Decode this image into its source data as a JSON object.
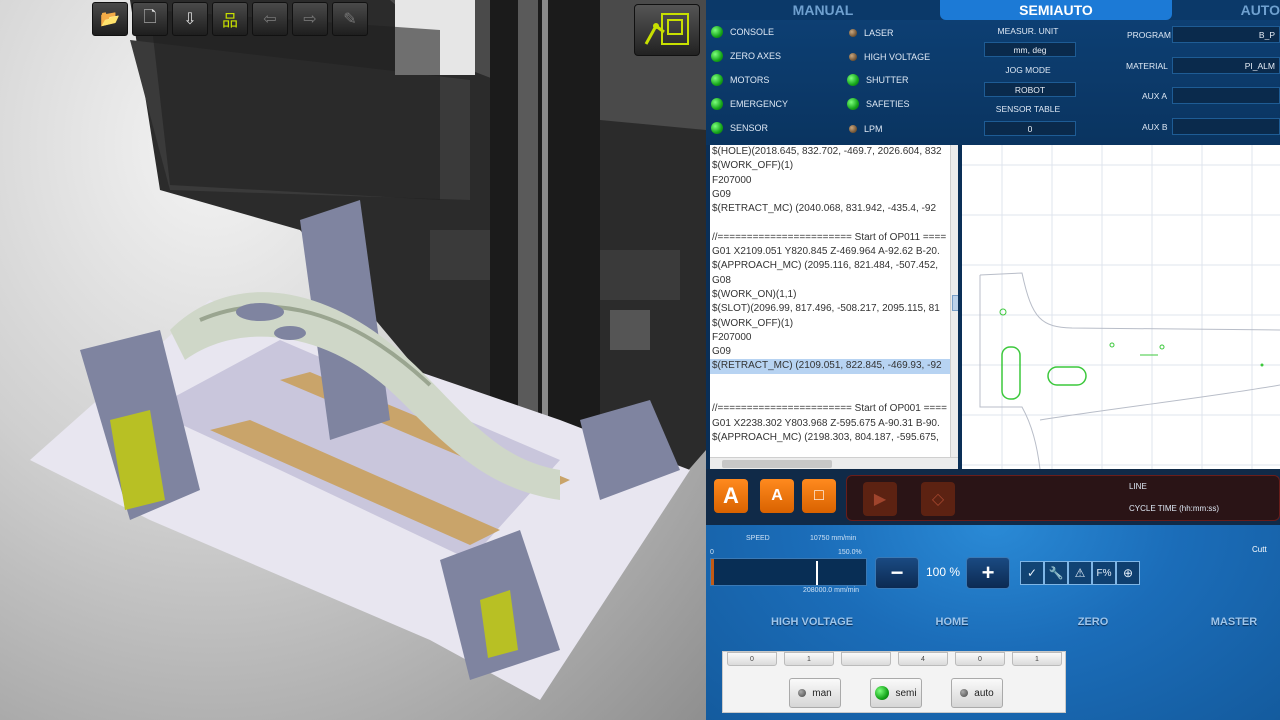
{
  "toolbar": {
    "items": [
      {
        "name": "open-folder",
        "glyph": "📂"
      },
      {
        "name": "new-document",
        "glyph": "🗋"
      },
      {
        "name": "export",
        "glyph": "⇩"
      },
      {
        "name": "hierarchy",
        "glyph": "品"
      },
      {
        "name": "arrow-left",
        "glyph": "⇦"
      },
      {
        "name": "arrow-right",
        "glyph": "⇨"
      },
      {
        "name": "pen",
        "glyph": "✎"
      }
    ]
  },
  "modes": [
    "MANUAL",
    "SEMIAUTO",
    "AUTO"
  ],
  "active_mode": "SEMIAUTO",
  "status": {
    "col1": [
      "CONSOLE",
      "ZERO AXES",
      "MOTORS",
      "EMERGENCY",
      "SENSOR"
    ],
    "col2": [
      "LASER",
      "HIGH VOLTAGE",
      "SHUTTER",
      "SAFETIES",
      "LPM"
    ],
    "units": [
      {
        "label": "MEASUR. UNIT",
        "value": "mm, deg"
      },
      {
        "label": "JOG MODE",
        "value": "ROBOT"
      },
      {
        "label": "SENSOR TABLE",
        "value": "0"
      }
    ],
    "fields": [
      {
        "label": "PROGRAM",
        "value": "B_P"
      },
      {
        "label": "MATERIAL",
        "value": "PI_ALM"
      },
      {
        "label": "AUX A",
        "value": ""
      },
      {
        "label": "AUX B",
        "value": ""
      }
    ]
  },
  "code": {
    "lines": [
      "$(HOLE)(2018.645, 832.702, -469.7, 2026.604, 832",
      "$(WORK_OFF)(1)",
      "F207000",
      "G09",
      "$(RETRACT_MC) (2040.068, 831.942, -435.4, -92",
      "",
      "//======================= Start of OP011 ====",
      "G01 X2109.051 Y820.845 Z-469.964 A-92.62 B-20.",
      "$(APPROACH_MC) (2095.116, 821.484, -507.452,",
      "G08",
      "$(WORK_ON)(1,1)",
      "$(SLOT)(2096.99, 817.496, -508.217, 2095.115, 81",
      "$(WORK_OFF)(1)",
      "F207000",
      "G09",
      "$(RETRACT_MC) (2109.051, 822.845, -469.93, -92",
      "",
      "",
      "//======================= Start of OP001 ====",
      "G01 X2238.302 Y803.968 Z-595.675 A-90.31 B-90.",
      "$(APPROACH_MC) (2198.303, 804.187, -595.675,"
    ],
    "highlight_index": 15
  },
  "actions": {
    "buttons": [
      "A",
      "A",
      "□"
    ],
    "run": [
      "play",
      "jog"
    ],
    "line_label": "LINE",
    "cycle_time_label": "CYCLE TIME (hh:mm:ss)"
  },
  "speed": {
    "label": "SPEED",
    "top_value": "10750 mm/min",
    "percent_max": "150.0%",
    "bottom_value": "208000.0 mm/min",
    "zero": "0",
    "override": "100 %",
    "override_fraction": 0.67
  },
  "commands": [
    "HIGH VOLTAGE",
    "HOME",
    "ZERO",
    "MASTER"
  ],
  "right_tab": "Cutt",
  "keypad": {
    "top_keys": [
      "0",
      "1",
      "",
      "4",
      "0",
      "1"
    ],
    "modes": [
      {
        "label": "man",
        "on": false
      },
      {
        "label": "semi",
        "on": true
      },
      {
        "label": "auto",
        "on": false
      }
    ]
  },
  "colors": {
    "accent_orange": "#ff7a0f",
    "led_green": "#15a51a",
    "panel_blue": "#0a2f57"
  }
}
